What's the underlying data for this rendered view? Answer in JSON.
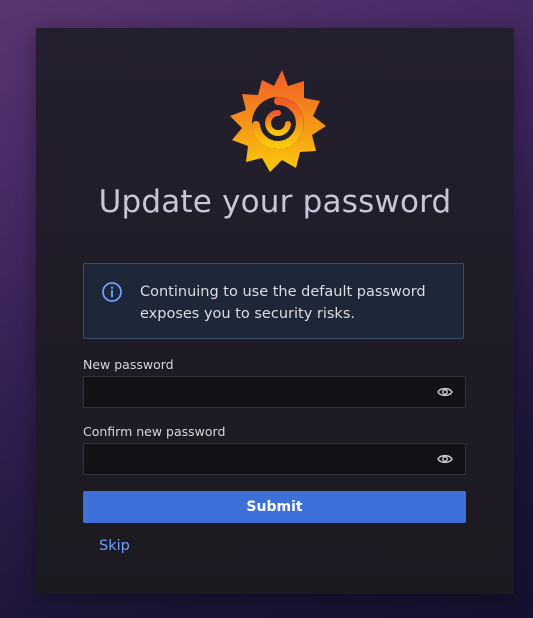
{
  "page": {
    "title": "Update your password"
  },
  "logo": {
    "icon": "grafana-logo-icon",
    "colors": [
      "#f05a28",
      "#fbca0a"
    ]
  },
  "alert": {
    "icon": "info-circle-icon",
    "message": "Continuing to use the default password exposes you to security risks.",
    "accent": "#6e9fff"
  },
  "form": {
    "new_password": {
      "label": "New password",
      "value": "",
      "toggle_icon": "eye-icon"
    },
    "confirm_password": {
      "label": "Confirm new password",
      "value": "",
      "toggle_icon": "eye-icon"
    },
    "submit_label": "Submit",
    "skip_label": "Skip"
  },
  "colors": {
    "primary": "#3d71d9",
    "link": "#6e9fff",
    "card_bg": "#1f1b26"
  }
}
